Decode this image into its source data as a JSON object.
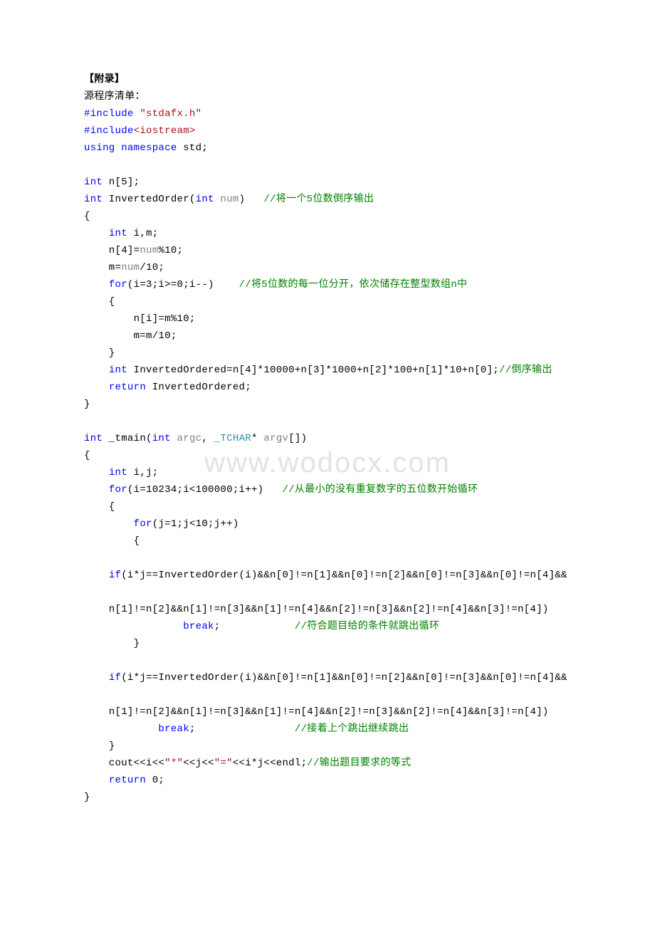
{
  "header": {
    "title": "【附录】",
    "subtitle": "源程序清单："
  },
  "watermark": "www.wodocx.com",
  "code": [
    [
      {
        "t": "#include ",
        "c": "blue"
      },
      {
        "t": "\"stdafx.h\"",
        "c": "red"
      }
    ],
    [
      {
        "t": "#include",
        "c": "blue"
      },
      {
        "t": "<iostream>",
        "c": "red"
      }
    ],
    [
      {
        "t": "using ",
        "c": "blue"
      },
      {
        "t": "namespace",
        "c": "blue"
      },
      {
        "t": " std;",
        "c": "black"
      }
    ],
    [
      {
        "t": "",
        "c": "black"
      }
    ],
    [
      {
        "t": "int",
        "c": "blue"
      },
      {
        "t": " n[5];",
        "c": "black"
      }
    ],
    [
      {
        "t": "int",
        "c": "blue"
      },
      {
        "t": " InvertedOrder(",
        "c": "black"
      },
      {
        "t": "int",
        "c": "blue"
      },
      {
        "t": " ",
        "c": "black"
      },
      {
        "t": "num",
        "c": "gray"
      },
      {
        "t": ")   ",
        "c": "black"
      },
      {
        "t": "//将一个5位数倒序输出",
        "c": "green"
      }
    ],
    [
      {
        "t": "{",
        "c": "black"
      }
    ],
    [
      {
        "t": "    ",
        "c": "black"
      },
      {
        "t": "int",
        "c": "blue"
      },
      {
        "t": " i,m;",
        "c": "black"
      }
    ],
    [
      {
        "t": "    n[4]=",
        "c": "black"
      },
      {
        "t": "num",
        "c": "gray"
      },
      {
        "t": "%10;",
        "c": "black"
      }
    ],
    [
      {
        "t": "    m=",
        "c": "black"
      },
      {
        "t": "num",
        "c": "gray"
      },
      {
        "t": "/10;",
        "c": "black"
      }
    ],
    [
      {
        "t": "    ",
        "c": "black"
      },
      {
        "t": "for",
        "c": "blue"
      },
      {
        "t": "(i=3;i>=0;i--)    ",
        "c": "black"
      },
      {
        "t": "//将5位数的每一位分开，依次储存在整型数组n中",
        "c": "green"
      }
    ],
    [
      {
        "t": "    {",
        "c": "black"
      }
    ],
    [
      {
        "t": "        n[i]=m%10;",
        "c": "black"
      }
    ],
    [
      {
        "t": "        m=m/10;",
        "c": "black"
      }
    ],
    [
      {
        "t": "    }",
        "c": "black"
      }
    ],
    [
      {
        "t": "    ",
        "c": "black"
      },
      {
        "t": "int",
        "c": "blue"
      },
      {
        "t": " InvertedOrdered=n[4]*10000+n[3]*1000+n[2]*100+n[1]*10+n[0];",
        "c": "black"
      },
      {
        "t": "//倒序输出",
        "c": "green"
      }
    ],
    [
      {
        "t": "    ",
        "c": "black"
      },
      {
        "t": "return",
        "c": "blue"
      },
      {
        "t": " InvertedOrdered;",
        "c": "black"
      }
    ],
    [
      {
        "t": "}",
        "c": "black"
      }
    ],
    [
      {
        "t": "",
        "c": "black"
      }
    ],
    [
      {
        "t": "int",
        "c": "blue"
      },
      {
        "t": " _tmain(",
        "c": "black"
      },
      {
        "t": "int",
        "c": "blue"
      },
      {
        "t": " ",
        "c": "black"
      },
      {
        "t": "argc",
        "c": "gray"
      },
      {
        "t": ", ",
        "c": "black"
      },
      {
        "t": "_TCHAR",
        "c": "teal"
      },
      {
        "t": "* ",
        "c": "black"
      },
      {
        "t": "argv",
        "c": "gray"
      },
      {
        "t": "[])",
        "c": "black"
      }
    ],
    [
      {
        "t": "{",
        "c": "black"
      }
    ],
    [
      {
        "t": "    ",
        "c": "black"
      },
      {
        "t": "int",
        "c": "blue"
      },
      {
        "t": " i,j;",
        "c": "black"
      }
    ],
    [
      {
        "t": "    ",
        "c": "black"
      },
      {
        "t": "for",
        "c": "blue"
      },
      {
        "t": "(i=10234;i<100000;i++)   ",
        "c": "black"
      },
      {
        "t": "//从最小的没有重复数字的五位数开始循环",
        "c": "green"
      }
    ],
    [
      {
        "t": "    {",
        "c": "black"
      }
    ],
    [
      {
        "t": "        ",
        "c": "black"
      },
      {
        "t": "for",
        "c": "blue"
      },
      {
        "t": "(j=1;j<10;j++)",
        "c": "black"
      }
    ],
    [
      {
        "t": "        {",
        "c": "black"
      }
    ],
    [
      {
        "t": "",
        "c": "black"
      }
    ],
    [
      {
        "t": "    ",
        "c": "black"
      },
      {
        "t": "if",
        "c": "blue"
      },
      {
        "t": "(i*j==InvertedOrder(i)&&n[0]!=n[1]&&n[0]!=n[2]&&n[0]!=n[3]&&n[0]!=n[4]&&",
        "c": "black"
      }
    ],
    [
      {
        "t": "",
        "c": "black"
      }
    ],
    [
      {
        "t": "    n[1]!=n[2]&&n[1]!=n[3]&&n[1]!=n[4]&&n[2]!=n[3]&&n[2]!=n[4]&&n[3]!=n[4])",
        "c": "black"
      }
    ],
    [
      {
        "t": "                ",
        "c": "black"
      },
      {
        "t": "break",
        "c": "blue"
      },
      {
        "t": ";            ",
        "c": "black"
      },
      {
        "t": "//符合题目给的条件就跳出循环",
        "c": "green"
      }
    ],
    [
      {
        "t": "        }",
        "c": "black"
      }
    ],
    [
      {
        "t": "",
        "c": "black"
      }
    ],
    [
      {
        "t": "    ",
        "c": "black"
      },
      {
        "t": "if",
        "c": "blue"
      },
      {
        "t": "(i*j==InvertedOrder(i)&&n[0]!=n[1]&&n[0]!=n[2]&&n[0]!=n[3]&&n[0]!=n[4]&&",
        "c": "black"
      }
    ],
    [
      {
        "t": "",
        "c": "black"
      }
    ],
    [
      {
        "t": "    n[1]!=n[2]&&n[1]!=n[3]&&n[1]!=n[4]&&n[2]!=n[3]&&n[2]!=n[4]&&n[3]!=n[4])",
        "c": "black"
      }
    ],
    [
      {
        "t": "            ",
        "c": "black"
      },
      {
        "t": "break",
        "c": "blue"
      },
      {
        "t": ";                ",
        "c": "black"
      },
      {
        "t": "//接着上个跳出继续跳出",
        "c": "green"
      }
    ],
    [
      {
        "t": "    }",
        "c": "black"
      }
    ],
    [
      {
        "t": "    cout<<i<<",
        "c": "black"
      },
      {
        "t": "\"*\"",
        "c": "red"
      },
      {
        "t": "<<j<<",
        "c": "black"
      },
      {
        "t": "\"=\"",
        "c": "red"
      },
      {
        "t": "<<i*j<<endl;",
        "c": "black"
      },
      {
        "t": "//输出题目要求的等式",
        "c": "green"
      }
    ],
    [
      {
        "t": "    ",
        "c": "black"
      },
      {
        "t": "return",
        "c": "blue"
      },
      {
        "t": " 0;",
        "c": "black"
      }
    ],
    [
      {
        "t": "}",
        "c": "black"
      }
    ]
  ]
}
